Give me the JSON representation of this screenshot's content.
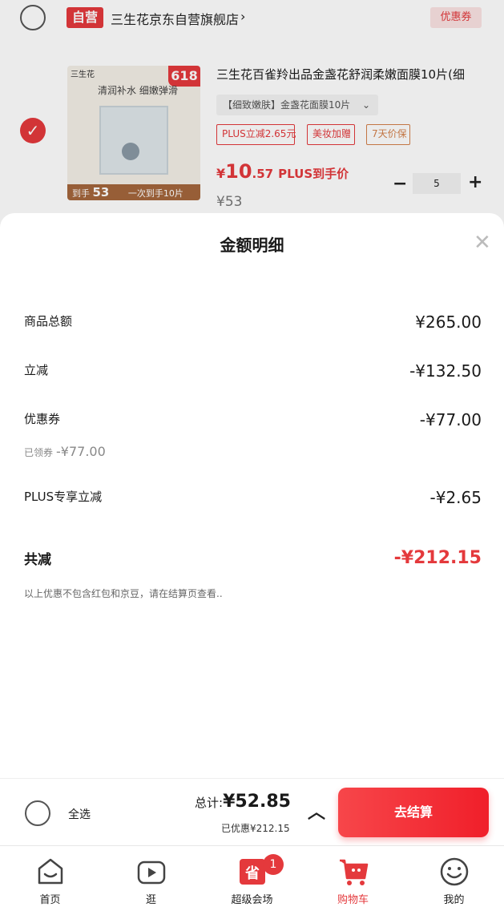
{
  "shop": {
    "self_badge": "自营",
    "name": "三生花京东自营旗舰店",
    "arrow": "›",
    "coupon_button": "优惠券"
  },
  "item": {
    "image": {
      "brand": "三生花",
      "tag": "618",
      "slogan": "清润补水 细嫩弹滑",
      "price_band_prefix": "到手",
      "price_band_value": "53",
      "price_band_suffix": "一次到手10片"
    },
    "title": "三生花百雀羚出品金盏花舒润柔嫩面膜10片(细",
    "spec": "【细致嫩肤】金盏花面膜10片",
    "promo_tags": [
      "PLUS立减2.65元",
      "美妆加赠",
      "7天价保"
    ],
    "plus_price": {
      "currency": "¥",
      "integer": "10",
      "decimal": ".57",
      "label": "PLUS到手价"
    },
    "original_price": "¥53",
    "quantity": "5"
  },
  "sheet": {
    "title": "金额明细",
    "rows": [
      {
        "label": "商品总额",
        "value": "¥265.00"
      },
      {
        "label": "立减",
        "value": "-¥132.50"
      },
      {
        "label": "优惠券",
        "value": "-¥77.00"
      },
      {
        "label": "PLUS专享立减",
        "value": "-¥2.65"
      }
    ],
    "coupon_claimed_label": "已领券",
    "coupon_claimed_value": "-¥77.00",
    "total_label": "共减",
    "total_value": "-¥212.15",
    "disclaimer": "以上优惠不包含红包和京豆，请在结算页查看.."
  },
  "checkout": {
    "select_all": "全选",
    "total_label": "总计:",
    "total_value": "¥52.85",
    "saved": "已优惠¥212.15",
    "button": "去结算"
  },
  "tabbar": {
    "home": "首页",
    "stroll": "逛",
    "super": "超级会场",
    "super_icon_char": "省",
    "super_badge": "1",
    "cart": "购物车",
    "mine": "我的"
  },
  "colors": {
    "accent": "#e4393c",
    "plus_tag_alt": "#d4804a"
  }
}
